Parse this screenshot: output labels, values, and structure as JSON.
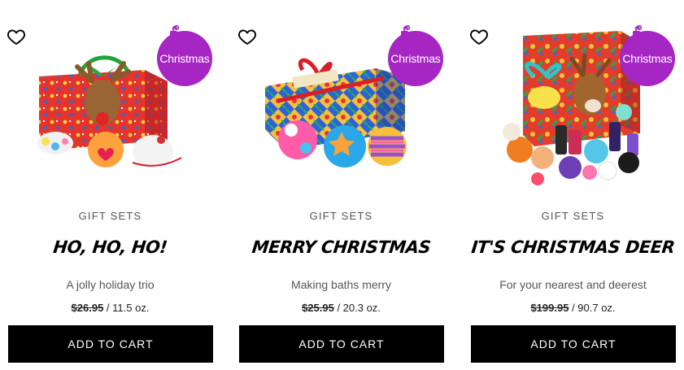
{
  "products": [
    {
      "badge": "Christmas",
      "category": "GIFT SETS",
      "name": "HO, HO, HO!",
      "tagline": "A jolly holiday trio",
      "price": "$26.95",
      "size": " / 11.5 oz.",
      "cta": "ADD TO CART"
    },
    {
      "badge": "Christmas",
      "category": "GIFT SETS",
      "name": "MERRY CHRISTMAS",
      "tagline": "Making baths merry",
      "price": "$25.95",
      "size": " / 20.3 oz.",
      "cta": "ADD TO CART"
    },
    {
      "badge": "Christmas",
      "category": "GIFT SETS",
      "name": "IT'S CHRISTMAS DEER",
      "tagline": "For your nearest and deerest",
      "price": "$199.95",
      "size": " / 90.7 oz.",
      "cta": "ADD TO CART"
    }
  ],
  "icons": {
    "wishlist": "heart-outline-icon",
    "badge_hook": "ornament-hook-icon"
  },
  "colors": {
    "badge": "#a626c4",
    "button": "#000000",
    "button_text": "#ffffff"
  }
}
